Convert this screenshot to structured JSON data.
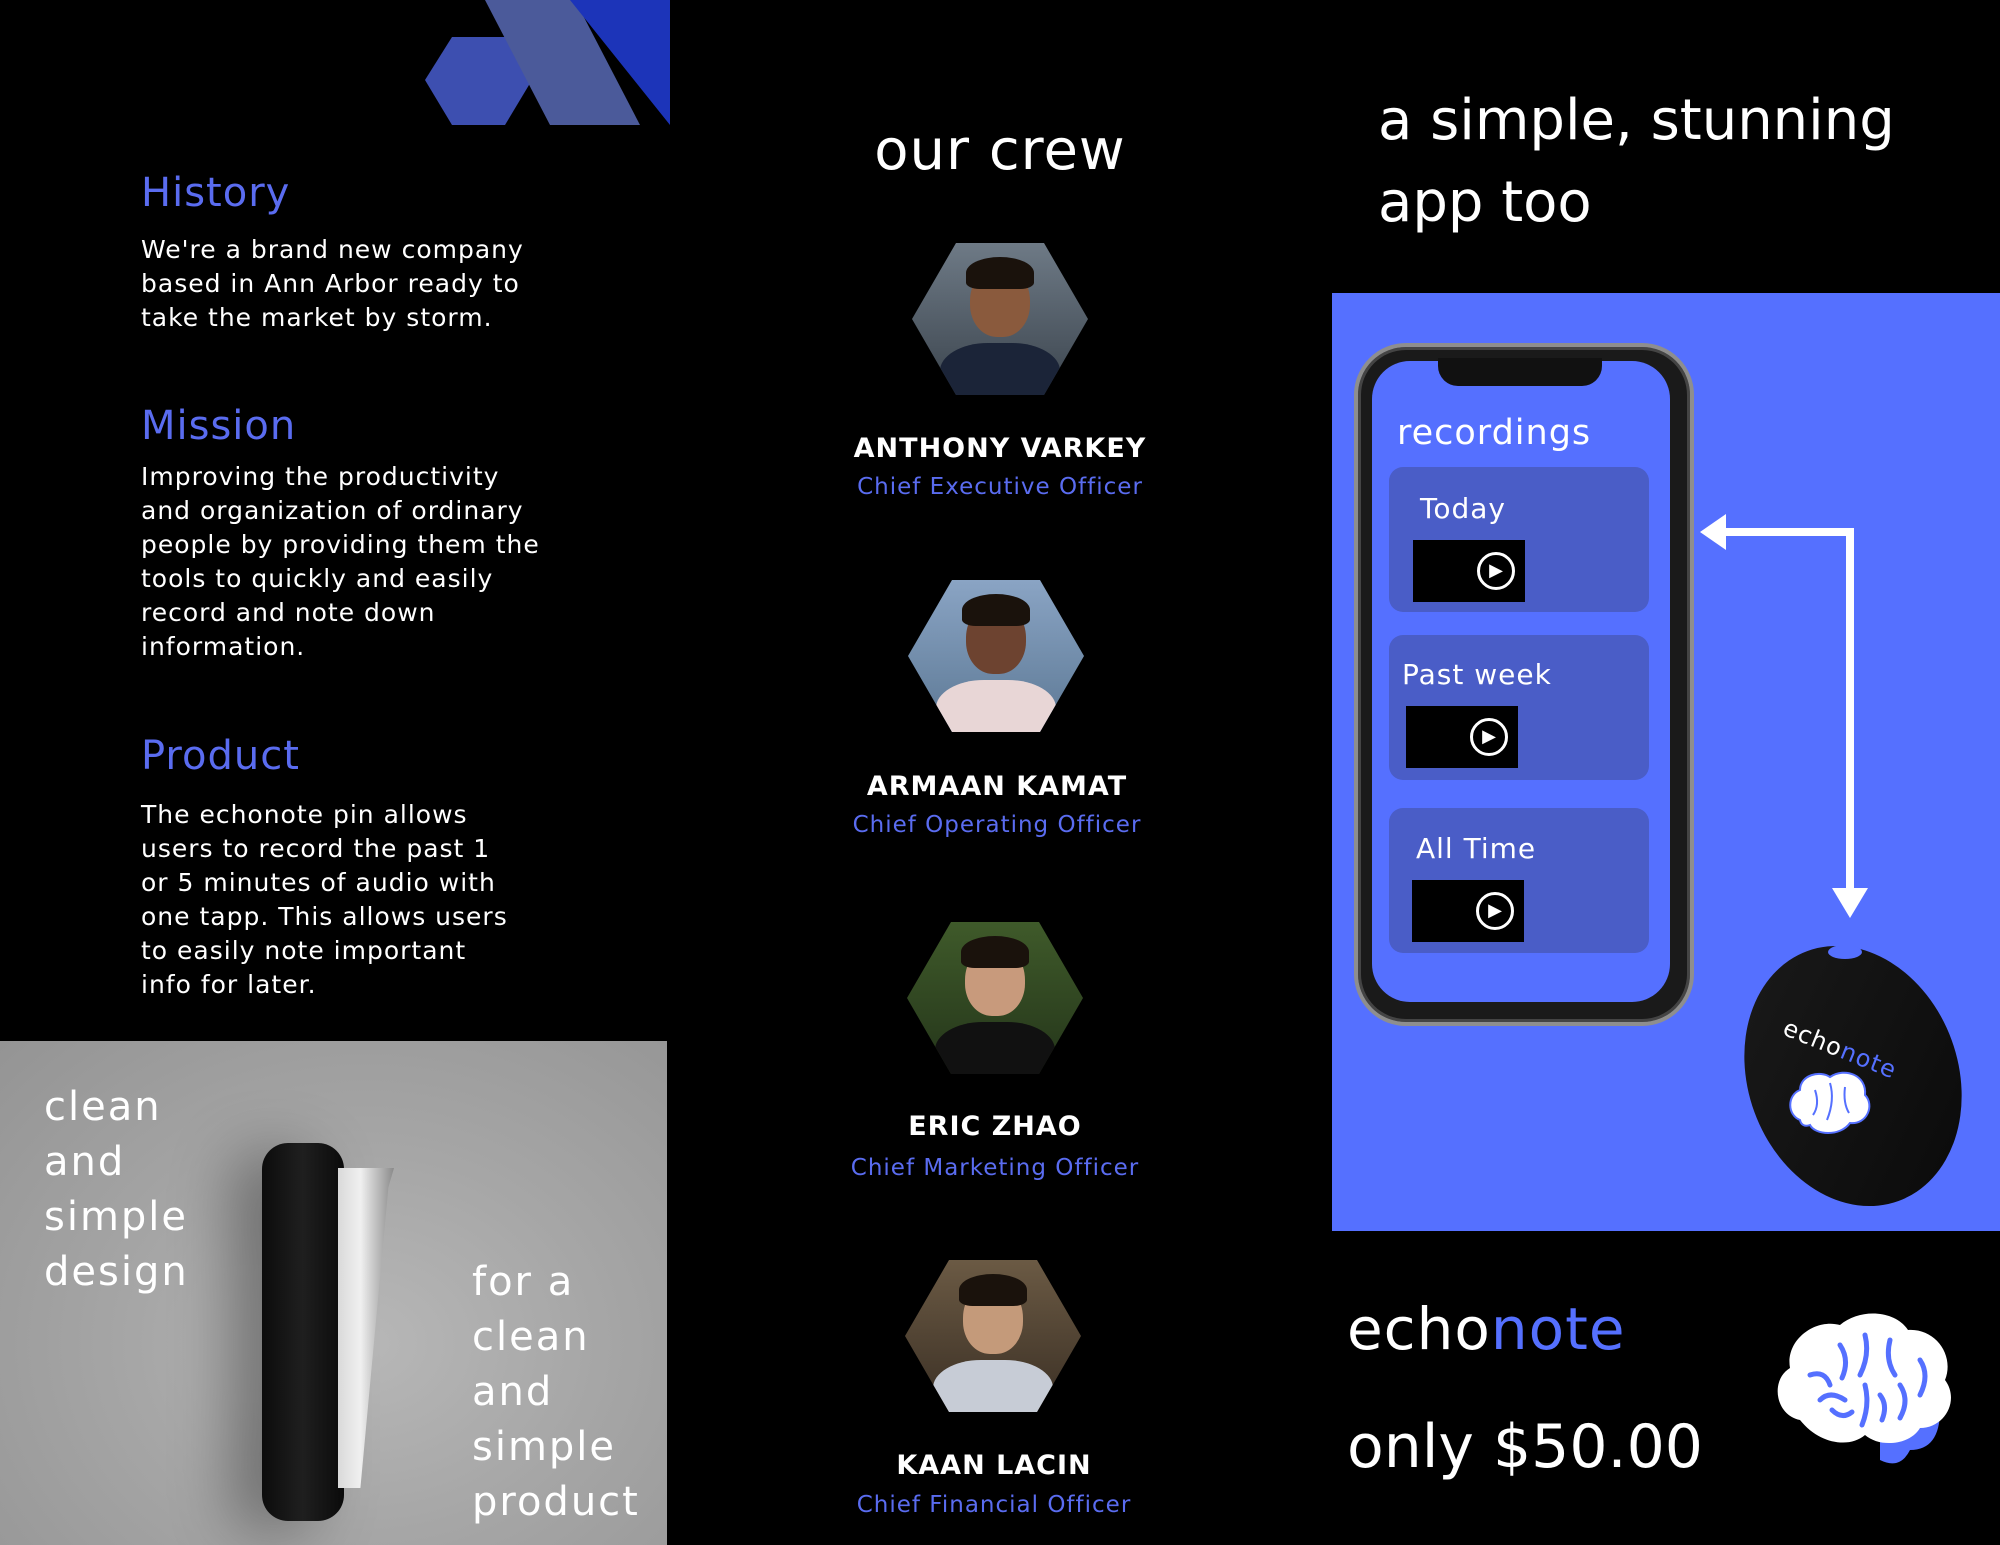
{
  "left": {
    "history": {
      "title": "History",
      "body": "We're a brand new company based in Ann Arbor ready to take the market by storm."
    },
    "mission": {
      "title": "Mission",
      "body": "Improving the productivity and organization of ordinary people by providing them the tools to quickly and easily record and note down information."
    },
    "product": {
      "title": "Product",
      "body": "The echonote pin allows users to record the past 1 or 5 minutes of audio with one tapp. This allows users to easily note important info for later."
    },
    "promo": {
      "line1": [
        "clean",
        "and",
        "simple",
        "design"
      ],
      "line2": [
        "for a",
        "clean",
        "and",
        "simple",
        "product"
      ]
    }
  },
  "crew": {
    "title": "our crew",
    "members": [
      {
        "name": "ANTHONY VARKEY",
        "role": "Chief Executive Officer"
      },
      {
        "name": "ARMAAN KAMAT",
        "role": "Chief Operating Officer"
      },
      {
        "name": "ERIC ZHAO",
        "role": "Chief Marketing Officer"
      },
      {
        "name": "KAAN LACIN",
        "role": "Chief Financial Officer"
      }
    ]
  },
  "app": {
    "title_line1": "a simple, stunning",
    "title_line2": "app too",
    "screen_title": "recordings",
    "cards": [
      {
        "label": "Today"
      },
      {
        "label": "Past week"
      },
      {
        "label": "All Time"
      }
    ],
    "device_label_echo": "echo",
    "device_label_note": "note"
  },
  "brand": {
    "echo": "echo",
    "note": "note",
    "price": "only $50.00"
  },
  "colors": {
    "accent": "#5570ff",
    "accent_text": "#5a6cf0",
    "background": "#000000"
  }
}
